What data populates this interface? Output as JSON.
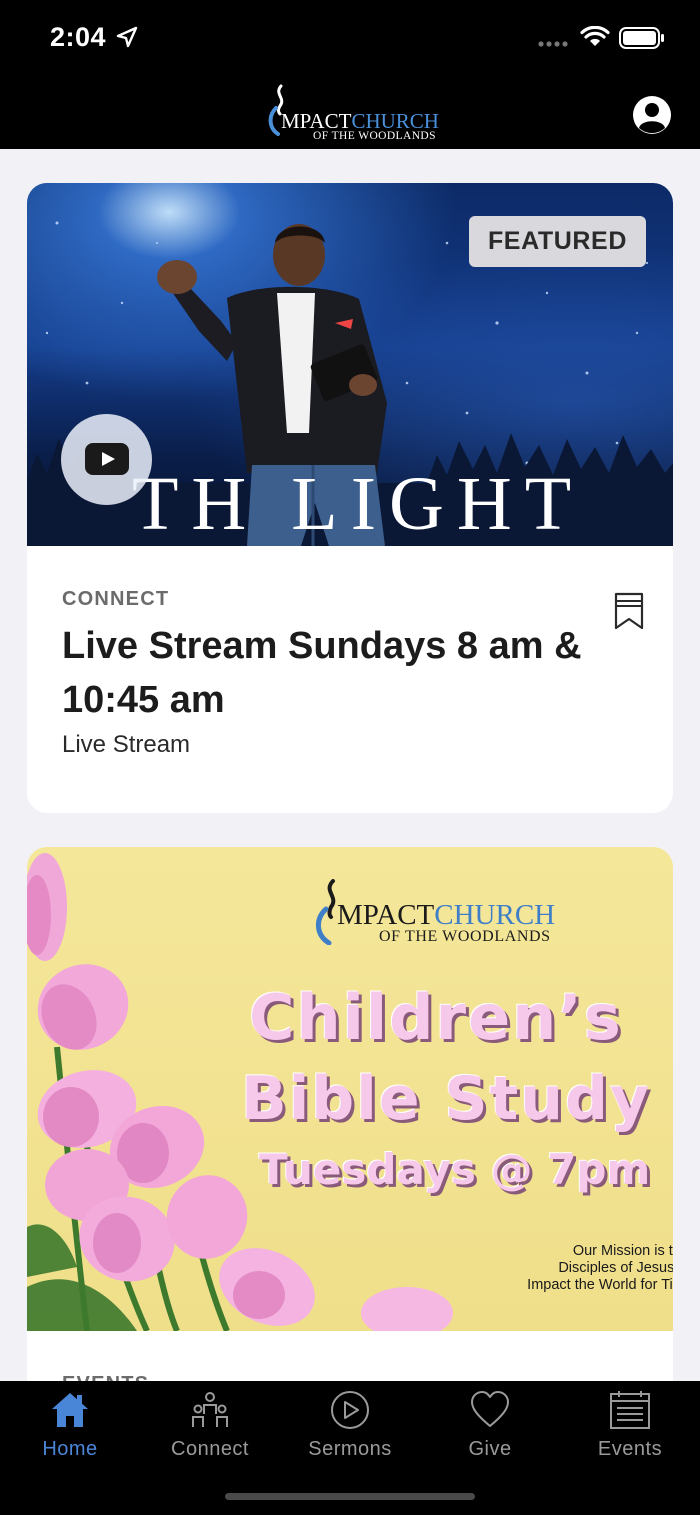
{
  "status_bar": {
    "time": "2:04"
  },
  "header": {
    "logo_text_dark": "MPACT",
    "logo_text_blue": "CHURCH",
    "logo_subtitle": "OF THE WOODLANDS"
  },
  "feed": [
    {
      "badge": "FEATURED",
      "hero_text": "TH  LIGHT",
      "category": "CONNECT",
      "title": "Live Stream Sundays 8 am & 10:45 am",
      "subtitle": "Live Stream"
    },
    {
      "poster_logo_dark": "MPACT",
      "poster_logo_blue": "CHURCH",
      "poster_logo_subtitle": "OF THE WOODLANDS",
      "poster_line1": "Children’s",
      "poster_line2": "Bible Study",
      "poster_line3": "Tuesdays @ 7pm",
      "mission_line1": "Our Mission is to Mo",
      "mission_line2": "Disciples of Jesus Chri",
      "mission_line3": "Impact the World for Time a",
      "category": "EVENTS"
    }
  ],
  "tabs": [
    {
      "label": "Home",
      "icon": "home-icon",
      "active": true
    },
    {
      "label": "Connect",
      "icon": "people-icon",
      "active": false
    },
    {
      "label": "Sermons",
      "icon": "play-circle-icon",
      "active": false
    },
    {
      "label": "Give",
      "icon": "heart-icon",
      "active": false
    },
    {
      "label": "Events",
      "icon": "calendar-icon",
      "active": false
    }
  ],
  "colors": {
    "accent": "#4a86d8",
    "tab_inactive": "#9a9a9a",
    "background": "#f2f2f6"
  }
}
